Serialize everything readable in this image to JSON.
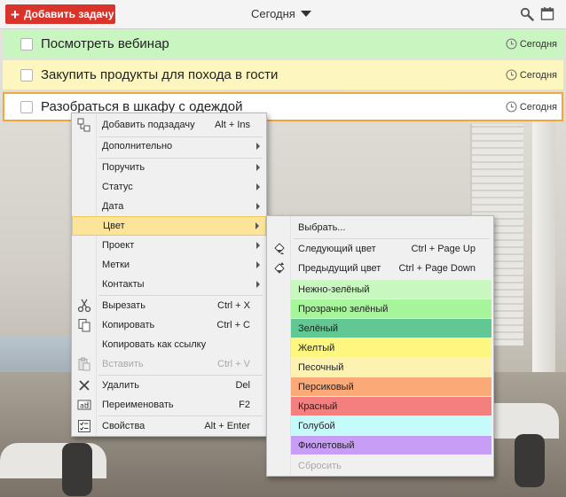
{
  "toolbar": {
    "add_task_label": "Добавить задачу",
    "view_label": "Сегодня",
    "search_icon": "search-icon",
    "calendar_icon": "calendar-icon"
  },
  "tasks": [
    {
      "title": "Посмотреть вебинар",
      "due": "Сегодня",
      "color": "#c8f5c0"
    },
    {
      "title": "Закупить продукты для похода в гости",
      "due": "Сегодня",
      "color": "#fdf7bf"
    },
    {
      "title": "Разобраться в шкафу с одеждой",
      "due": "Сегодня",
      "color": "#ffffff"
    }
  ],
  "context_menu": {
    "add_subtask": {
      "label": "Добавить подзадачу",
      "shortcut": "Alt + Ins"
    },
    "more": {
      "label": "Дополнительно"
    },
    "assign": {
      "label": "Поручить"
    },
    "status": {
      "label": "Статус"
    },
    "date": {
      "label": "Дата"
    },
    "color": {
      "label": "Цвет"
    },
    "project": {
      "label": "Проект"
    },
    "tags": {
      "label": "Метки"
    },
    "contacts": {
      "label": "Контакты"
    },
    "cut": {
      "label": "Вырезать",
      "shortcut": "Ctrl + X"
    },
    "copy": {
      "label": "Копировать",
      "shortcut": "Ctrl + C"
    },
    "copy_link": {
      "label": "Копировать как ссылку"
    },
    "paste": {
      "label": "Вставить",
      "shortcut": "Ctrl + V"
    },
    "delete": {
      "label": "Удалить",
      "shortcut": "Del"
    },
    "rename": {
      "label": "Переименовать",
      "shortcut": "F2"
    },
    "properties": {
      "label": "Свойства",
      "shortcut": "Alt + Enter"
    }
  },
  "color_submenu": {
    "choose": {
      "label": "Выбрать..."
    },
    "next": {
      "label": "Следующий цвет",
      "shortcut": "Ctrl + Page Up"
    },
    "prev": {
      "label": "Предыдущий цвет",
      "shortcut": "Ctrl + Page Down"
    },
    "swatches": [
      {
        "label": "Нежно-зелёный",
        "color": "#c8f7c0"
      },
      {
        "label": "Прозрачно зелёный",
        "color": "#a7f59a"
      },
      {
        "label": "Зелёный",
        "color": "#62c893"
      },
      {
        "label": "Желтый",
        "color": "#fdf77f"
      },
      {
        "label": "Песочный",
        "color": "#fdf2b0"
      },
      {
        "label": "Персиковый",
        "color": "#fca978"
      },
      {
        "label": "Красный",
        "color": "#f37f7f"
      },
      {
        "label": "Голубой",
        "color": "#c6fbfb"
      },
      {
        "label": "Фиолетовый",
        "color": "#c79df5"
      }
    ],
    "reset": {
      "label": "Сбросить"
    }
  },
  "colors": {
    "accent": "#d9342b",
    "selected_border": "#f1a73a",
    "menu_highlight": "#fce49a"
  }
}
